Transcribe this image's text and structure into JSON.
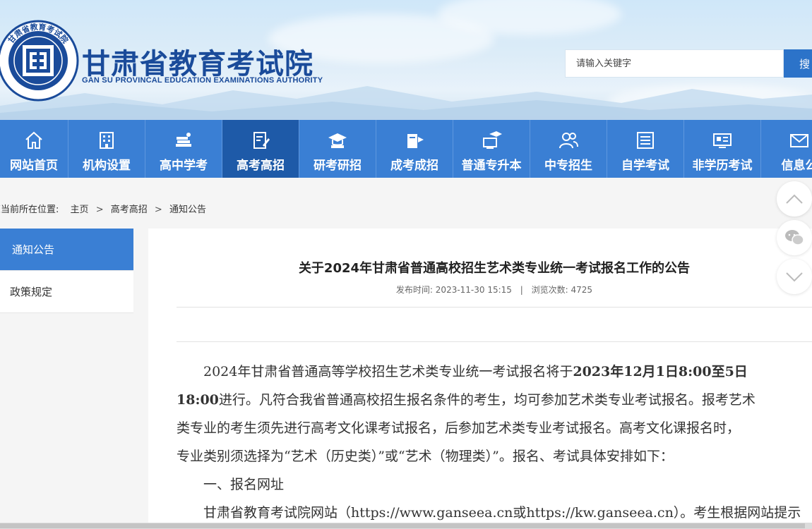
{
  "header": {
    "emblem_text": "甘肃省教育考试院",
    "title": "甘肃省教育考试院",
    "subtitle": "GAN SU PROVINCAL EDUCATION EXAMINATIONS AUTHORITY",
    "search_placeholder": "请输入关键字",
    "search_button": "搜"
  },
  "nav": {
    "items": [
      {
        "label": "网站首页",
        "icon": "home-icon"
      },
      {
        "label": "机构设置",
        "icon": "building-icon"
      },
      {
        "label": "高中学考",
        "icon": "books-icon"
      },
      {
        "label": "高考高招",
        "icon": "exam-pen-icon",
        "active": true
      },
      {
        "label": "研考研招",
        "icon": "graduation-cap-icon"
      },
      {
        "label": "成考成招",
        "icon": "flag-book-icon"
      },
      {
        "label": "普通专升本",
        "icon": "graduate-computer-icon"
      },
      {
        "label": "中专招生",
        "icon": "users-icon"
      },
      {
        "label": "自学考试",
        "icon": "list-icon"
      },
      {
        "label": "非学历考试",
        "icon": "id-card-icon"
      },
      {
        "label": "信息公",
        "icon": "mail-icon"
      }
    ]
  },
  "breadcrumb": {
    "prefix": "您当前所在位置:",
    "home": "主页",
    "sep": ">",
    "level1": "高考高招",
    "level2": "通知公告"
  },
  "sidebar": {
    "items": [
      {
        "label": "通知公告",
        "active": true
      },
      {
        "label": "政策规定"
      }
    ]
  },
  "article": {
    "title": "关于2024年甘肃省普通高校招生艺术类专业统一考试报名工作的公告",
    "meta_label_time": "发布时间:",
    "meta_time": "2023-11-30 15:15",
    "meta_sep": "|",
    "meta_label_views": "浏览次数:",
    "meta_views": "4725",
    "p1_a": "　　2024年甘肃省普通高等学校招生艺术类专业统一考试报名将于",
    "p1_b": "2023年12月1日8:00至5日",
    "p2_a": "18:00",
    "p2_b": "进行。凡符合我省普通高校招生报名条件的考生，均可参加艺术类专业考试报名。报考艺术",
    "p3": "类专业的考生须先进行高考文化课考试报名，后参加艺术类专业考试报名。高考文化课报名时，",
    "p4": "专业类别须选择为“艺术（历史类）”或“艺术（物理类）”。报名、考试具体安排如下：",
    "h1": "　　一、报名网址",
    "p5": "　　甘肃省教育考试院网站（https://www.ganseea.cn或https://kw.ganseea.cn）。考生根据网站提示"
  },
  "colors": {
    "nav_bg": "#3a7fd4",
    "nav_active": "#1e5aa8",
    "brand_text": "#1a4b9a"
  }
}
